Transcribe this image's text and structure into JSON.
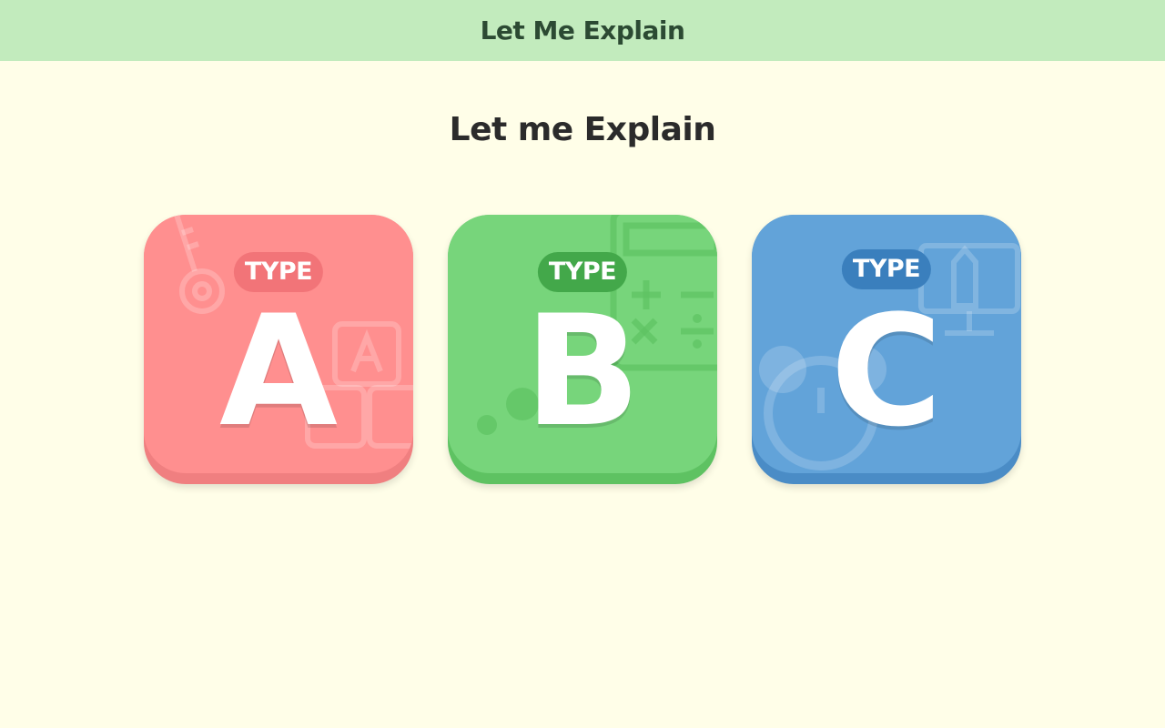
{
  "header": {
    "title": "Let Me Explain"
  },
  "main": {
    "heading": "Let me Explain",
    "cards": [
      {
        "badge": "TYPE",
        "letter": "A",
        "color": "#ff8f8f",
        "icons": [
          "key-icon",
          "alphabet-blocks-icon"
        ]
      },
      {
        "badge": "TYPE",
        "letter": "B",
        "color": "#77d57b",
        "icons": [
          "calculator-icon"
        ]
      },
      {
        "badge": "TYPE",
        "letter": "C",
        "color": "#62a3d9",
        "icons": [
          "alarm-clock-icon",
          "monitor-pencil-icon"
        ]
      }
    ]
  },
  "colors": {
    "background": "#fffee8",
    "header_bg": "#c2ebbd"
  }
}
